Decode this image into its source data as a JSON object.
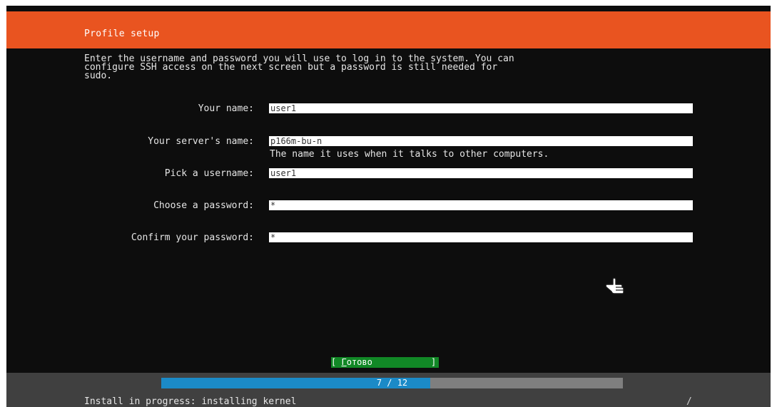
{
  "header": {
    "title": "Profile setup"
  },
  "intro": "Enter the username and password you will use to log in to the system. You can\nconfigure SSH access on the next screen but a password is still needed for\nsudo.",
  "fields": {
    "your_name": {
      "label": "Your name:",
      "value": "user1"
    },
    "server_name": {
      "label": "Your server's name:",
      "value": "p166m-bu-n",
      "hint": "The name it uses when it talks to other computers."
    },
    "username": {
      "label": "Pick a username:",
      "value": "user1"
    },
    "password": {
      "label": "Choose a password:",
      "value": "*"
    },
    "confirm_password": {
      "label": "Confirm your password:",
      "value": "*"
    }
  },
  "done_button": {
    "open": "[ ",
    "accel": "Г",
    "rest": "отово",
    "close": "]"
  },
  "progress": {
    "current": 7,
    "total": 12,
    "text": "7 / 12"
  },
  "status": {
    "text": "Install in progress: installing kernel",
    "mark": "/"
  },
  "colors": {
    "accent": "#e95420",
    "button": "#118826",
    "progress": "#1b8ac7"
  },
  "icons": {
    "pointer": "hand-pointer-icon"
  }
}
